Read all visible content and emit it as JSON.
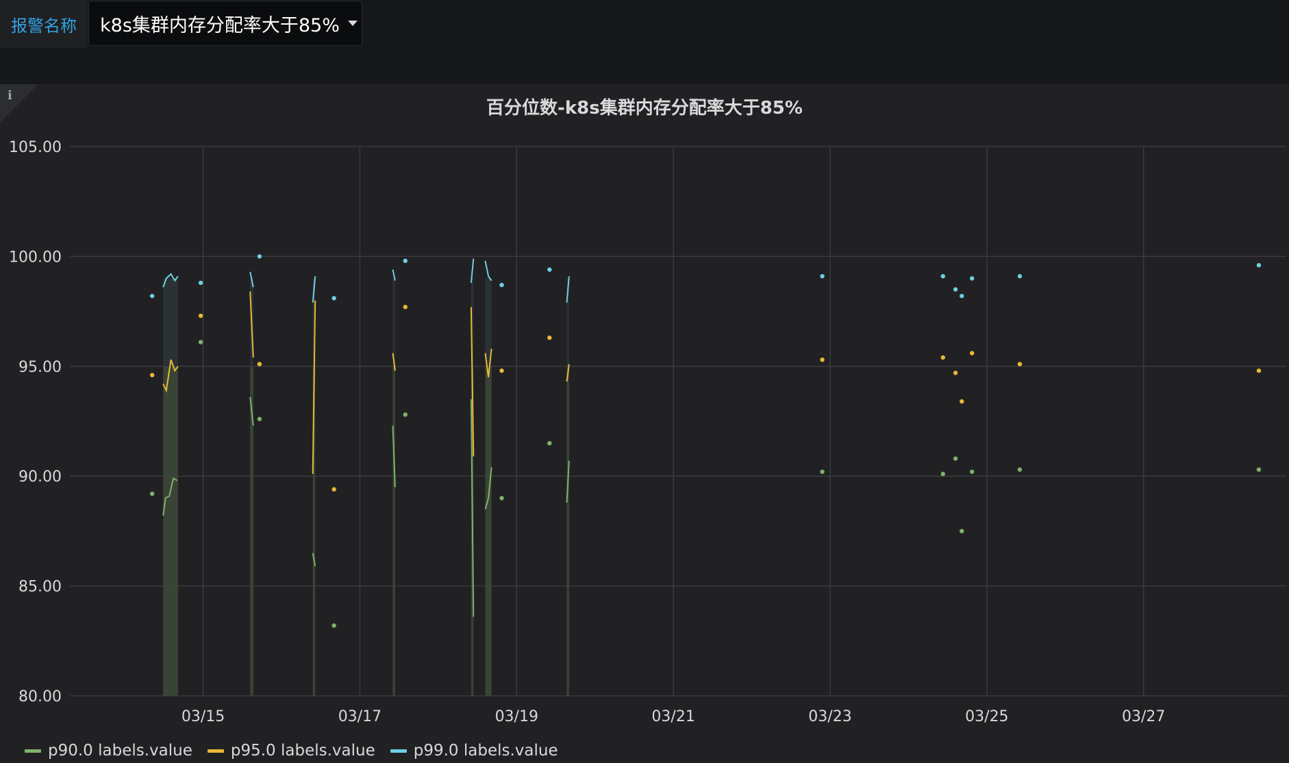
{
  "variable": {
    "label": "报警名称",
    "value": "k8s集群内存分配率大于85%"
  },
  "panel": {
    "info_icon": "i"
  },
  "chart_data": {
    "type": "line",
    "title": "百分位数-k8s集群内存分配率大于85%",
    "xlabel": "",
    "ylabel": "",
    "ylim": [
      80,
      105
    ],
    "yticks": [
      "80.00",
      "85.00",
      "90.00",
      "95.00",
      "100.00",
      "105.00"
    ],
    "xlim": [
      13.3,
      28.82
    ],
    "xticks": [
      {
        "label": "03/15",
        "value": 15
      },
      {
        "label": "03/17",
        "value": 17
      },
      {
        "label": "03/19",
        "value": 19
      },
      {
        "label": "03/21",
        "value": 21
      },
      {
        "label": "03/23",
        "value": 23
      },
      {
        "label": "03/25",
        "value": 25
      },
      {
        "label": "03/27",
        "value": 27
      }
    ],
    "grid": true,
    "legend_position": "bottom-left",
    "series": [
      {
        "name": "p90.0 labels.value",
        "color": "#7eb26d",
        "segments": [
          [
            [
              14.49,
              88.2
            ],
            [
              14.52,
              89.0
            ],
            [
              14.57,
              89.1
            ],
            [
              14.62,
              89.9
            ],
            [
              14.67,
              89.8
            ]
          ],
          [
            [
              15.6,
              93.6
            ],
            [
              15.64,
              92.3
            ]
          ],
          [
            [
              16.4,
              86.5
            ],
            [
              16.43,
              85.9
            ]
          ],
          [
            [
              17.42,
              92.3
            ],
            [
              17.45,
              89.5
            ]
          ],
          [
            [
              18.42,
              93.5
            ],
            [
              18.45,
              83.6
            ]
          ],
          [
            [
              18.6,
              88.5
            ],
            [
              18.64,
              89.0
            ],
            [
              18.68,
              90.4
            ]
          ],
          [
            [
              19.64,
              88.8
            ],
            [
              19.67,
              90.7
            ]
          ]
        ],
        "points": [
          [
            14.35,
            89.2
          ],
          [
            14.97,
            96.1
          ],
          [
            15.72,
            92.6
          ],
          [
            16.67,
            83.2
          ],
          [
            17.58,
            92.8
          ],
          [
            18.81,
            89.0
          ],
          [
            19.42,
            91.5
          ],
          [
            22.9,
            90.2
          ],
          [
            24.44,
            90.1
          ],
          [
            24.6,
            90.8
          ],
          [
            24.68,
            87.5
          ],
          [
            24.81,
            90.2
          ],
          [
            25.42,
            90.3
          ],
          [
            28.47,
            90.3
          ]
        ]
      },
      {
        "name": "p95.0 labels.value",
        "color": "#eab839",
        "segments": [
          [
            [
              14.49,
              94.2
            ],
            [
              14.53,
              93.9
            ],
            [
              14.59,
              95.3
            ],
            [
              14.64,
              94.8
            ],
            [
              14.68,
              95.0
            ]
          ],
          [
            [
              15.6,
              98.4
            ],
            [
              15.64,
              95.4
            ]
          ],
          [
            [
              16.4,
              90.1
            ],
            [
              16.43,
              98.0
            ]
          ],
          [
            [
              17.42,
              95.6
            ],
            [
              17.45,
              94.8
            ]
          ],
          [
            [
              18.42,
              97.7
            ],
            [
              18.45,
              90.9
            ]
          ],
          [
            [
              18.6,
              95.6
            ],
            [
              18.64,
              94.5
            ],
            [
              18.68,
              95.8
            ]
          ],
          [
            [
              19.64,
              94.3
            ],
            [
              19.67,
              95.1
            ]
          ]
        ],
        "points": [
          [
            14.35,
            94.6
          ],
          [
            14.97,
            97.3
          ],
          [
            15.72,
            95.1
          ],
          [
            16.67,
            89.4
          ],
          [
            17.58,
            97.7
          ],
          [
            18.81,
            94.8
          ],
          [
            19.42,
            96.3
          ],
          [
            22.9,
            95.3
          ],
          [
            24.44,
            95.4
          ],
          [
            24.6,
            94.7
          ],
          [
            24.68,
            93.4
          ],
          [
            24.81,
            95.6
          ],
          [
            25.42,
            95.1
          ],
          [
            28.47,
            94.8
          ]
        ]
      },
      {
        "name": "p99.0 labels.value",
        "color": "#6ed0e0",
        "segments": [
          [
            [
              14.49,
              98.6
            ],
            [
              14.53,
              99.0
            ],
            [
              14.59,
              99.2
            ],
            [
              14.64,
              98.9
            ],
            [
              14.68,
              99.1
            ]
          ],
          [
            [
              15.6,
              99.3
            ],
            [
              15.64,
              98.6
            ]
          ],
          [
            [
              16.4,
              97.9
            ],
            [
              16.43,
              99.1
            ]
          ],
          [
            [
              17.42,
              99.4
            ],
            [
              17.45,
              98.9
            ]
          ],
          [
            [
              18.42,
              98.8
            ],
            [
              18.45,
              99.9
            ]
          ],
          [
            [
              18.6,
              99.8
            ],
            [
              18.64,
              99.1
            ],
            [
              18.68,
              98.9
            ]
          ],
          [
            [
              19.64,
              97.9
            ],
            [
              19.67,
              99.1
            ]
          ]
        ],
        "points": [
          [
            14.35,
            98.2
          ],
          [
            14.97,
            98.8
          ],
          [
            15.72,
            100.0
          ],
          [
            16.67,
            98.1
          ],
          [
            17.58,
            99.8
          ],
          [
            18.81,
            98.7
          ],
          [
            19.42,
            99.4
          ],
          [
            22.9,
            99.1
          ],
          [
            24.44,
            99.1
          ],
          [
            24.6,
            98.5
          ],
          [
            24.68,
            98.2
          ],
          [
            24.81,
            99.0
          ],
          [
            25.42,
            99.1
          ],
          [
            28.47,
            99.6
          ]
        ]
      }
    ],
    "fill_bands": [
      [
        14.49,
        14.68
      ],
      [
        15.6,
        15.64
      ],
      [
        16.4,
        16.43
      ],
      [
        17.42,
        17.45
      ],
      [
        18.42,
        18.45
      ],
      [
        18.6,
        18.68
      ],
      [
        19.64,
        19.67
      ]
    ]
  }
}
